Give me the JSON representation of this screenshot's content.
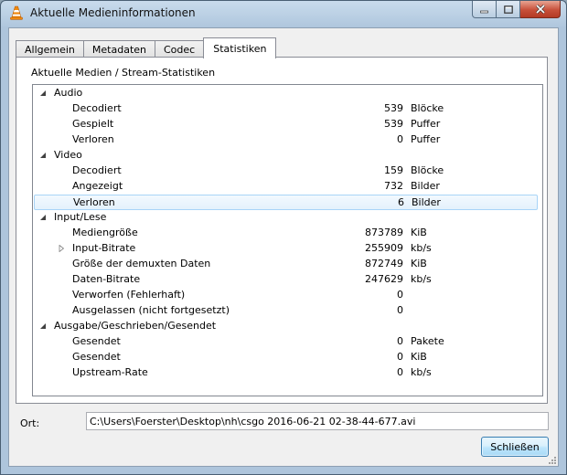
{
  "window": {
    "title": "Aktuelle Medieninformationen"
  },
  "tabs": [
    {
      "label": "Allgemein"
    },
    {
      "label": "Metadaten"
    },
    {
      "label": "Codec"
    },
    {
      "label": "Statistiken"
    }
  ],
  "active_tab": "Statistiken",
  "panel": {
    "heading": "Aktuelle Medien / Stream-Statistiken"
  },
  "tree": [
    {
      "label": "Audio",
      "level": 0,
      "expander": "expanded",
      "value": "",
      "unit": ""
    },
    {
      "label": "Decodiert",
      "level": 1,
      "expander": "none",
      "value": "539",
      "unit": "Blöcke"
    },
    {
      "label": "Gespielt",
      "level": 1,
      "expander": "none",
      "value": "539",
      "unit": "Puffer"
    },
    {
      "label": "Verloren",
      "level": 1,
      "expander": "none",
      "value": "0",
      "unit": "Puffer"
    },
    {
      "label": "Video",
      "level": 0,
      "expander": "expanded",
      "value": "",
      "unit": ""
    },
    {
      "label": "Decodiert",
      "level": 1,
      "expander": "none",
      "value": "159",
      "unit": "Blöcke"
    },
    {
      "label": "Angezeigt",
      "level": 1,
      "expander": "none",
      "value": "732",
      "unit": "Bilder"
    },
    {
      "label": "Verloren",
      "level": 1,
      "expander": "none",
      "value": "6",
      "unit": "Bilder",
      "selected": true
    },
    {
      "label": "Input/Lese",
      "level": 0,
      "expander": "expanded",
      "value": "",
      "unit": ""
    },
    {
      "label": "Mediengröße",
      "level": 1,
      "expander": "none",
      "value": "873789",
      "unit": "KiB"
    },
    {
      "label": "Input-Bitrate",
      "level": 1,
      "expander": "collapsed",
      "value": "255909",
      "unit": "kb/s"
    },
    {
      "label": "Größe der demuxten Daten",
      "level": 1,
      "expander": "none",
      "value": "872749",
      "unit": "KiB"
    },
    {
      "label": "Daten-Bitrate",
      "level": 1,
      "expander": "none",
      "value": "247629",
      "unit": "kb/s"
    },
    {
      "label": "Verworfen (Fehlerhaft)",
      "level": 1,
      "expander": "none",
      "value": "0",
      "unit": ""
    },
    {
      "label": "Ausgelassen (nicht fortgesetzt)",
      "level": 1,
      "expander": "none",
      "value": "0",
      "unit": ""
    },
    {
      "label": "Ausgabe/Geschrieben/Gesendet",
      "level": 0,
      "expander": "expanded",
      "value": "",
      "unit": ""
    },
    {
      "label": "Gesendet",
      "level": 1,
      "expander": "none",
      "value": "0",
      "unit": "Pakete"
    },
    {
      "label": "Gesendet",
      "level": 1,
      "expander": "none",
      "value": "0",
      "unit": "KiB"
    },
    {
      "label": "Upstream-Rate",
      "level": 1,
      "expander": "none",
      "value": "0",
      "unit": "kb/s"
    }
  ],
  "location": {
    "label": "Ort:",
    "value": "C:\\Users\\Foerster\\Desktop\\nh\\csgo 2016-06-21 02-38-44-677.avi"
  },
  "buttons": {
    "close_label": "Schließen"
  },
  "colors": {
    "selection_border": "#a8d4f7",
    "close_button": "#c7503a"
  },
  "icons": {
    "app": "vlc-cone-icon",
    "minimize": "minimize-icon",
    "maximize": "maximize-icon",
    "close": "close-icon",
    "expanded": "tree-expanded-icon",
    "collapsed": "tree-collapsed-icon"
  }
}
